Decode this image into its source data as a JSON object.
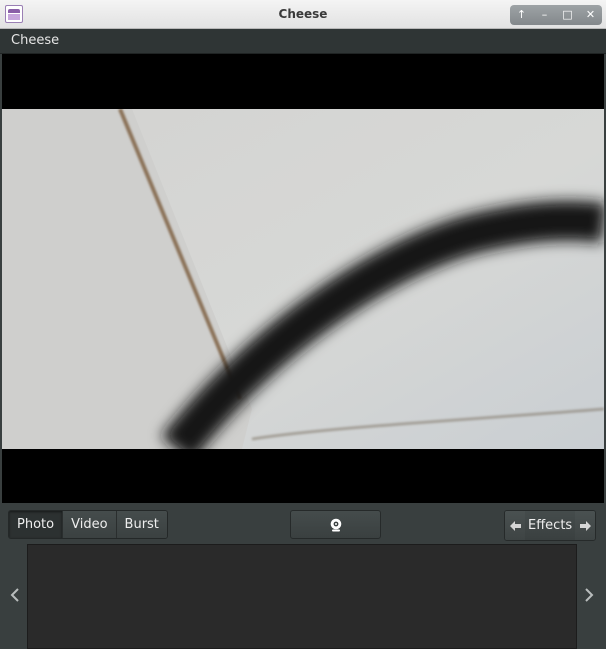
{
  "window": {
    "title": "Cheese"
  },
  "window_buttons": [
    "↑",
    "–",
    "□",
    "✕"
  ],
  "app_menu": {
    "label": "Cheese"
  },
  "modes": [
    "Photo",
    "Video",
    "Burst"
  ],
  "active_mode": "Photo",
  "effects": {
    "label": "Effects"
  },
  "icons": {
    "app": "cheese-app-icon",
    "shutter": "webcam-icon",
    "effects_prev": "arrow-left-icon",
    "effects_next": "arrow-right-icon",
    "thumbs_prev": "chevron-left-icon",
    "thumbs_next": "chevron-right-icon"
  }
}
